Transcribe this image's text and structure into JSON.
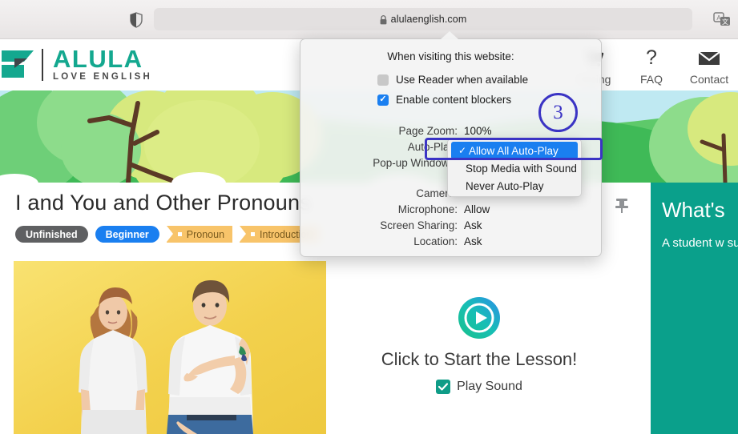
{
  "browser": {
    "shield_icon": "shield-icon",
    "lock_icon": "lock-icon",
    "url": "alulaenglish.com",
    "translate_icon": "translate-icon"
  },
  "site_header": {
    "logo": {
      "brand": "ALULA",
      "tagline": "LOVE ENGLISH",
      "brand_color": "#14a88f"
    },
    "nav": [
      {
        "label": "Pricing",
        "icon": "cart-icon"
      },
      {
        "label": "FAQ",
        "icon": "question-mark-icon"
      },
      {
        "label": "Contact",
        "icon": "envelope-icon"
      }
    ]
  },
  "lesson": {
    "title": "I and You and Other Pronouns",
    "badges": [
      {
        "label": "Unfinished",
        "style": "gray",
        "color": "#5f6062"
      },
      {
        "label": "Beginner",
        "style": "blue",
        "color": "#1a7ff0"
      }
    ],
    "tags": [
      {
        "label": "Pronoun"
      },
      {
        "label": "Introduction"
      }
    ],
    "pin_icon": "pushpin-icon",
    "photo_alt": "woman and man in white t-shirts on yellow background",
    "start": {
      "play_icon": "play-button-icon",
      "start_text": "Click to Start the Lesson!",
      "sound_checked": true,
      "sound_label": "Play Sound"
    }
  },
  "side_panel": {
    "heading": "What's",
    "body": "A student w subject pron or she will l each pronou pronoun to to another p",
    "bg_color": "#0aa08b"
  },
  "popover": {
    "title": "When visiting this website:",
    "checkboxes": [
      {
        "label": "Use Reader when available",
        "checked": false
      },
      {
        "label": "Enable content blockers",
        "checked": true
      }
    ],
    "settings_group_1": [
      {
        "key": "Page Zoom:",
        "value": "100%"
      },
      {
        "key": "Auto-Play:",
        "value": ""
      },
      {
        "key": "Pop-up Windows:",
        "value": ""
      }
    ],
    "settings_group_2": [
      {
        "key": "Camera:",
        "value": ""
      },
      {
        "key": "Microphone:",
        "value": "Allow"
      },
      {
        "key": "Screen Sharing:",
        "value": "Ask"
      },
      {
        "key": "Location:",
        "value": "Ask"
      }
    ],
    "dropdown": {
      "selected_check": "✓",
      "options": [
        {
          "label": "Allow All Auto-Play",
          "selected": true
        },
        {
          "label": "Stop Media with Sound",
          "selected": false
        },
        {
          "label": "Never Auto-Play",
          "selected": false
        }
      ],
      "highlight_color": "#1a7ff0",
      "focus_border_color": "#3b34c4"
    }
  },
  "annotation": {
    "step_number": "3",
    "color": "#3b34c4"
  }
}
